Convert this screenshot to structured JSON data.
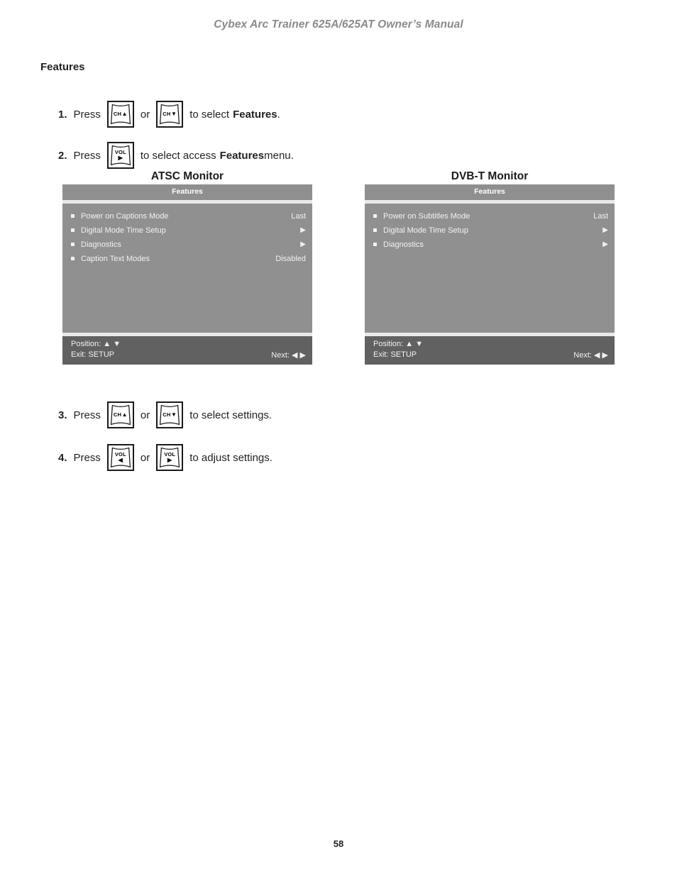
{
  "header": {
    "title": "Cybex Arc Trainer 625A/625AT Owner’s Manual"
  },
  "section": {
    "title": "Features"
  },
  "steps": [
    {
      "num": "1.",
      "text_before": "Press",
      "keys": [
        "CH▲",
        "CH▼"
      ],
      "separator": "or",
      "text_after_plain": "to select ",
      "text_after_bold": "Features",
      "text_end": "."
    },
    {
      "num": "2.",
      "text_before": "Press",
      "keys": [
        "VOL▶"
      ],
      "text_after_plain": "to select access ",
      "text_after_bold": "Features",
      "text_end": " menu."
    },
    {
      "num": "3.",
      "text_before": "Press",
      "keys": [
        "CH▲",
        "CH▼"
      ],
      "separator": "or",
      "text_after_plain": "to select settings.",
      "text_after_bold": "",
      "text_end": ""
    },
    {
      "num": "4.",
      "text_before": "Press",
      "keys": [
        "VOL◀",
        "VOL▶"
      ],
      "separator": "or",
      "text_after_plain": "to adjust settings.",
      "text_after_bold": "",
      "text_end": ""
    }
  ],
  "keys": {
    "ch_up": {
      "label": "CH",
      "arrow": "▲"
    },
    "ch_down": {
      "label": "CH",
      "arrow": "▼"
    },
    "vol_left": {
      "label": "VOL",
      "arrow": "◀"
    },
    "vol_right": {
      "label": "VOL",
      "arrow": "▶"
    }
  },
  "atsc": {
    "caption": "ATSC Monitor",
    "menu_title": "Features",
    "rows": [
      {
        "label": "Power on Captions Mode",
        "value": "Last",
        "is_arrow": false
      },
      {
        "label": "Digital Mode Time Setup",
        "value": "▶",
        "is_arrow": true
      },
      {
        "label": "Diagnostics",
        "value": "▶",
        "is_arrow": true
      },
      {
        "label": "Caption Text Modes",
        "value": "Disabled",
        "is_arrow": false
      }
    ],
    "footer": {
      "position": "Position: ▲ ▼",
      "exit": "Exit: SETUP",
      "next": "Next: ◀ ▶"
    }
  },
  "dvbt": {
    "caption": "DVB-T Monitor",
    "menu_title": "Features",
    "rows": [
      {
        "label": "Power on Subtitles Mode",
        "value": "Last",
        "is_arrow": false
      },
      {
        "label": "Digital Mode Time Setup",
        "value": "▶",
        "is_arrow": true
      },
      {
        "label": "Diagnostics",
        "value": "▶",
        "is_arrow": true
      }
    ],
    "footer": {
      "position": "Position: ▲ ▼",
      "exit": "Exit: SETUP",
      "next": "Next: ◀ ▶"
    }
  },
  "footer": {
    "page_number": "58"
  },
  "colors": {
    "header_text": "#8a8a8a",
    "osd_title_bar": "#8f8f8f",
    "osd_body": "#909090",
    "osd_footer": "#616161",
    "osd_separator": "#e9e9e9",
    "osd_text": "#f2f2f2"
  }
}
